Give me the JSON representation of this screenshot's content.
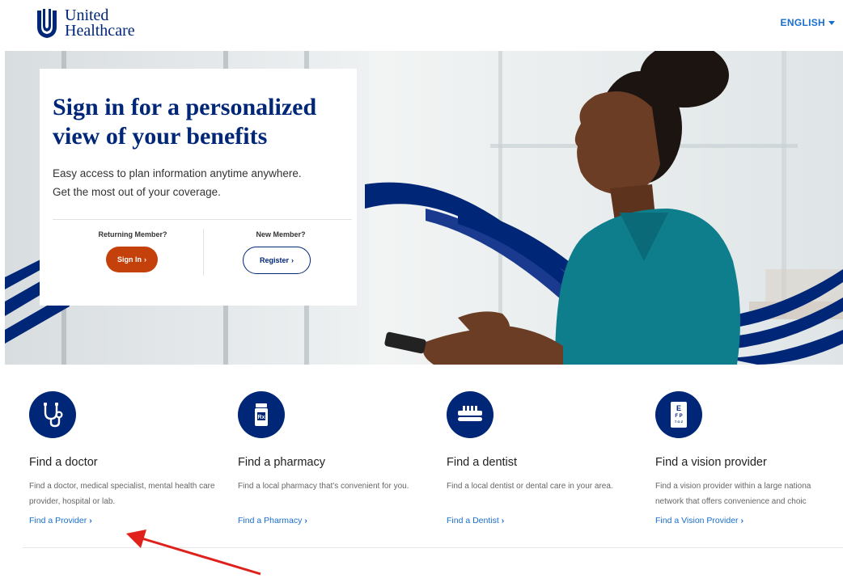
{
  "header": {
    "logo_line1": "United",
    "logo_line2": "Healthcare",
    "language": "ENGLISH"
  },
  "hero": {
    "title": "Sign in for a personalized view of your benefits",
    "subtitle_line1": "Easy access to plan information anytime anywhere.",
    "subtitle_line2": "Get the most out of your coverage.",
    "returning_label": "Returning Member?",
    "signin_label": "Sign In",
    "new_label": "New Member?",
    "register_label": "Register"
  },
  "features": [
    {
      "title": "Find a doctor",
      "desc": "Find a doctor, medical specialist, mental health care provider, hospital or lab.",
      "link": "Find a Provider",
      "icon": "stethoscope-icon"
    },
    {
      "title": "Find a pharmacy",
      "desc": "Find a local pharmacy that's convenient for you.",
      "link": "Find a Pharmacy",
      "icon": "pill-bottle-icon"
    },
    {
      "title": "Find a dentist",
      "desc": "Find a local dentist or dental care in your area.",
      "link": "Find a Dentist",
      "icon": "toothbrush-icon"
    },
    {
      "title": "Find a vision provider",
      "desc_line1": "Find a vision provider within a large nationa",
      "desc_line2": "network that offers convenience and choic",
      "link": "Find a Vision Provider",
      "icon": "eye-chart-icon"
    }
  ],
  "colors": {
    "brand_navy": "#002677",
    "link_blue": "#196ecf",
    "signin_orange": "#c4410b",
    "annotation_red": "#e0201b"
  }
}
